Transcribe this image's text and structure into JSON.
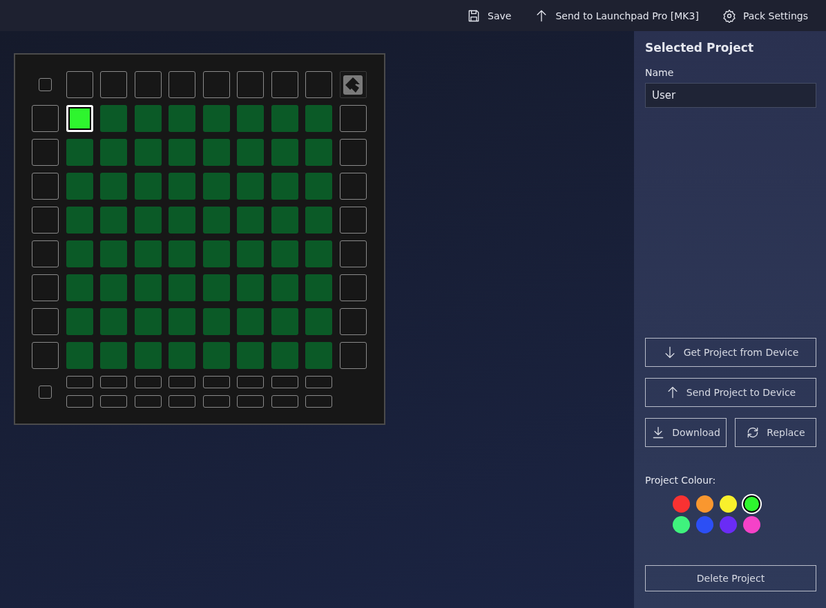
{
  "toolbar": [
    {
      "kind": "save",
      "label": "Save"
    },
    {
      "kind": "send",
      "label": "Send to Launchpad Pro [MK3]"
    },
    {
      "kind": "settings",
      "label": "Pack Settings"
    }
  ],
  "launchpad": {
    "rows": [
      [
        {
          "color": "#2ef52e",
          "selected": true
        },
        {
          "color": "#0b5a27",
          "selected": false
        },
        {
          "color": "#0b5a27",
          "selected": false
        },
        {
          "color": "#0b5a27",
          "selected": false
        },
        {
          "color": "#0b5a27",
          "selected": false
        },
        {
          "color": "#0b5a27",
          "selected": false
        },
        {
          "color": "#0b5a27",
          "selected": false
        },
        {
          "color": "#0b5a27",
          "selected": false
        }
      ],
      [
        {
          "color": "#0b5a27",
          "selected": false
        },
        {
          "color": "#0b5a27",
          "selected": false
        },
        {
          "color": "#0b5a27",
          "selected": false
        },
        {
          "color": "#0b5a27",
          "selected": false
        },
        {
          "color": "#0b5a27",
          "selected": false
        },
        {
          "color": "#0b5a27",
          "selected": false
        },
        {
          "color": "#0b5a27",
          "selected": false
        },
        {
          "color": "#0b5a27",
          "selected": false
        }
      ],
      [
        {
          "color": "#0b5a27",
          "selected": false
        },
        {
          "color": "#0b5a27",
          "selected": false
        },
        {
          "color": "#0b5a27",
          "selected": false
        },
        {
          "color": "#0b5a27",
          "selected": false
        },
        {
          "color": "#0b5a27",
          "selected": false
        },
        {
          "color": "#0b5a27",
          "selected": false
        },
        {
          "color": "#0b5a27",
          "selected": false
        },
        {
          "color": "#0b5a27",
          "selected": false
        }
      ],
      [
        {
          "color": "#0b5a27",
          "selected": false
        },
        {
          "color": "#0b5a27",
          "selected": false
        },
        {
          "color": "#0b5a27",
          "selected": false
        },
        {
          "color": "#0b5a27",
          "selected": false
        },
        {
          "color": "#0b5a27",
          "selected": false
        },
        {
          "color": "#0b5a27",
          "selected": false
        },
        {
          "color": "#0b5a27",
          "selected": false
        },
        {
          "color": "#0b5a27",
          "selected": false
        }
      ],
      [
        {
          "color": "#0b5a27",
          "selected": false
        },
        {
          "color": "#0b5a27",
          "selected": false
        },
        {
          "color": "#0b5a27",
          "selected": false
        },
        {
          "color": "#0b5a27",
          "selected": false
        },
        {
          "color": "#0b5a27",
          "selected": false
        },
        {
          "color": "#0b5a27",
          "selected": false
        },
        {
          "color": "#0b5a27",
          "selected": false
        },
        {
          "color": "#0b5a27",
          "selected": false
        }
      ],
      [
        {
          "color": "#0b5a27",
          "selected": false
        },
        {
          "color": "#0b5a27",
          "selected": false
        },
        {
          "color": "#0b5a27",
          "selected": false
        },
        {
          "color": "#0b5a27",
          "selected": false
        },
        {
          "color": "#0b5a27",
          "selected": false
        },
        {
          "color": "#0b5a27",
          "selected": false
        },
        {
          "color": "#0b5a27",
          "selected": false
        },
        {
          "color": "#0b5a27",
          "selected": false
        }
      ],
      [
        {
          "color": "#0b5a27",
          "selected": false
        },
        {
          "color": "#0b5a27",
          "selected": false
        },
        {
          "color": "#0b5a27",
          "selected": false
        },
        {
          "color": "#0b5a27",
          "selected": false
        },
        {
          "color": "#0b5a27",
          "selected": false
        },
        {
          "color": "#0b5a27",
          "selected": false
        },
        {
          "color": "#0b5a27",
          "selected": false
        },
        {
          "color": "#0b5a27",
          "selected": false
        }
      ],
      [
        {
          "color": "#0b5a27",
          "selected": false
        },
        {
          "color": "#0b5a27",
          "selected": false
        },
        {
          "color": "#0b5a27",
          "selected": false
        },
        {
          "color": "#0b5a27",
          "selected": false
        },
        {
          "color": "#0b5a27",
          "selected": false
        },
        {
          "color": "#0b5a27",
          "selected": false
        },
        {
          "color": "#0b5a27",
          "selected": false
        },
        {
          "color": "#0b5a27",
          "selected": false
        }
      ]
    ]
  },
  "sidebar": {
    "title": "Selected Project",
    "name_label": "Name",
    "name_value": "User",
    "actions": [
      {
        "kind": "download",
        "label": "Get Project from Device"
      },
      {
        "kind": "upload",
        "label": "Send Project to Device"
      }
    ],
    "file_actions": [
      {
        "kind": "save-down",
        "label": "Download"
      },
      {
        "kind": "swap",
        "label": "Replace"
      }
    ],
    "colour_label": "Project Colour:",
    "colours": [
      {
        "color": "#f93232",
        "selected": false
      },
      {
        "color": "#f9972f",
        "selected": false
      },
      {
        "color": "#f8f02c",
        "selected": false
      },
      {
        "color": "#2ef52e",
        "selected": true
      },
      {
        "color": "#3ff27d",
        "selected": false
      },
      {
        "color": "#2c4ff5",
        "selected": false
      },
      {
        "color": "#6a2cf5",
        "selected": false
      },
      {
        "color": "#f542c8",
        "selected": false
      }
    ],
    "delete_label": "Delete Project"
  }
}
